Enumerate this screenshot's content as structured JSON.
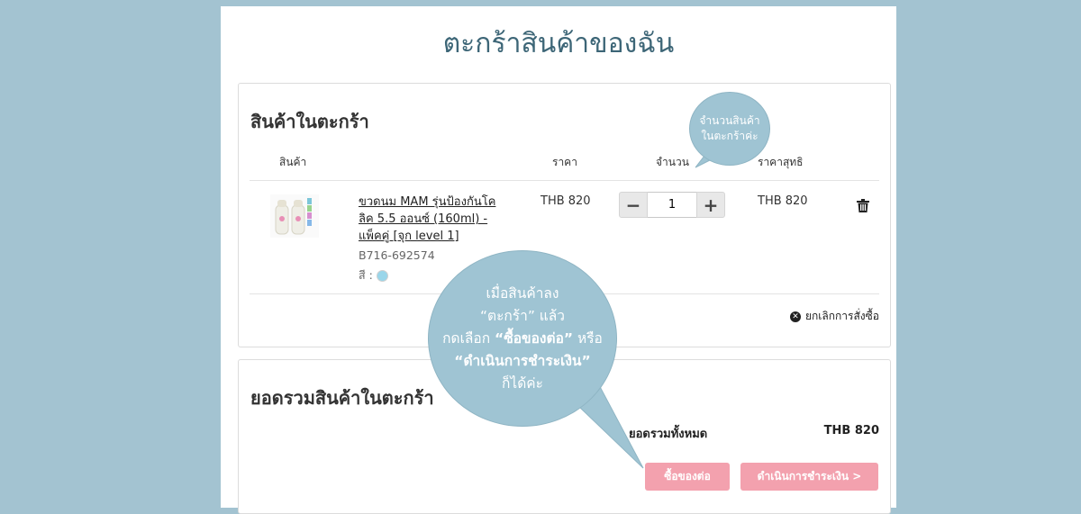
{
  "page": {
    "title": "ตะกร้าสินค้าของฉัน"
  },
  "cart": {
    "heading": "สินค้าในตะกร้า",
    "columns": {
      "product": "สินค้า",
      "price": "ราคา",
      "quantity": "จำนวน",
      "net_price": "ราคาสุทธิ"
    },
    "item": {
      "name": "ขวดนม MAM รุ่นป้องกันโคลิค 5.5 ออนซ์ (160ml) - แพ็คคู่ [จุก level 1]",
      "sku": "B716-692574",
      "color_label": "สี :",
      "color_hex": "#9ad6ea",
      "price": "THB 820",
      "quantity": "1",
      "net_price": "THB 820"
    },
    "cancel_order": "ยกเลิกการสั่งซื้อ"
  },
  "summary": {
    "heading": "ยอดรวมสินค้าในตะกร้า",
    "total_label": "ยอดรวมทั้งหมด",
    "total_value": "THB 820",
    "continue_label": "ซื้อของต่อ",
    "checkout_label": "ดำเนินการชำระเงิน >"
  },
  "bubbles": {
    "qty_line1": "จำนวนสินค้า",
    "qty_line2": "ในตะกร้าค่ะ",
    "main_line1": "เมื่อสินค้าลง",
    "main_line2": "“ตะกร้า” แล้ว",
    "main_line3_pre": "กดเลือก ",
    "main_line3_bold": "“ซื้อของต่อ”",
    "main_line3_post": " หรือ",
    "main_line4": "“ดำเนินการชำระเงิน”",
    "main_line5": "ก็ได้ค่ะ"
  },
  "colors": {
    "accent_button": "#f3a1ae",
    "bubble": "#9fc4d3",
    "background": "#a3c3d1",
    "title": "#3d6677"
  }
}
